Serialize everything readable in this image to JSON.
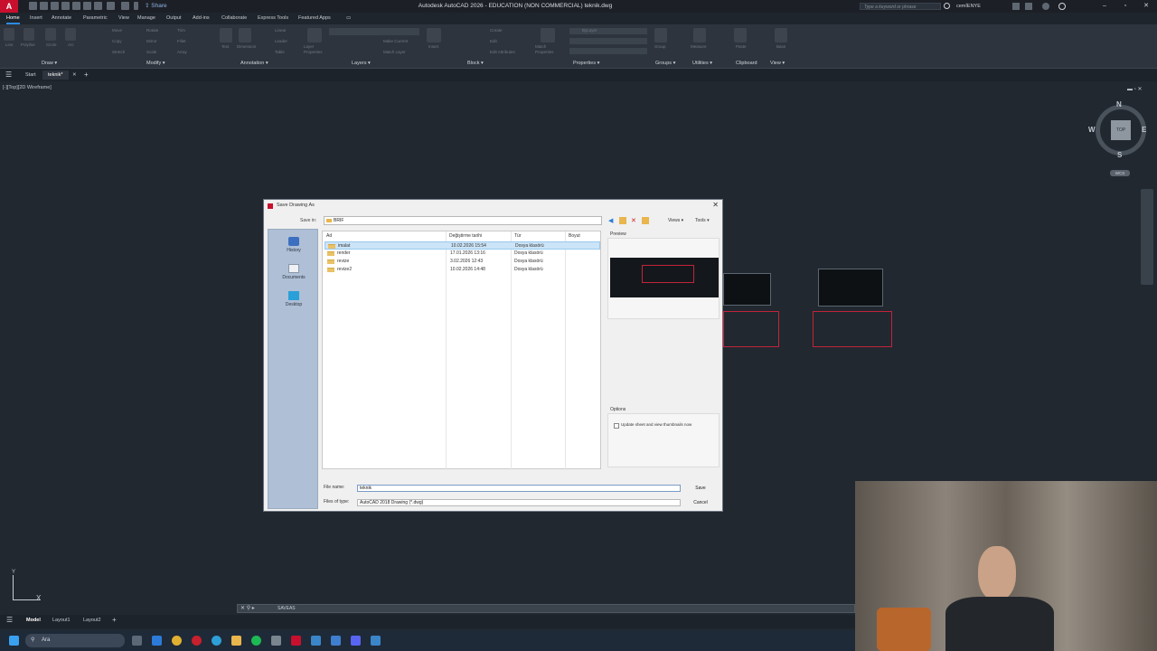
{
  "titlebar": {
    "app_logo": "A",
    "share_label": "Share",
    "window_title": "Autodesk AutoCAD 2026 - EDUCATION (NON COMMERCIAL)   teknik.dwg",
    "search_placeholder": "Type a keyword or phrase",
    "user_name": "cemİENYE"
  },
  "ribbon": {
    "tabs": [
      "Home",
      "Insert",
      "Annotate",
      "Parametric",
      "View",
      "Manage",
      "Output",
      "Add-ins",
      "Collaborate",
      "Express Tools",
      "Featured Apps"
    ],
    "active_tab": "Home",
    "panels": [
      "Draw ▾",
      "Modify ▾",
      "Annotation ▾",
      "Layers ▾",
      "Block ▾",
      "Properties ▾",
      "Groups ▾",
      "Utilities ▾",
      "Clipboard",
      "View ▾"
    ],
    "small_labels": {
      "line": "Line",
      "polyline": "Polyline",
      "circle": "Circle",
      "arc": "Arc",
      "move": "Move",
      "rotate": "Rotate",
      "trim": "Trim",
      "copy": "Copy",
      "mirror": "Mirror",
      "fillet": "Fillet",
      "stretch": "Stretch",
      "scale": "Scale",
      "array": "Array",
      "text": "Text",
      "dimension": "Dimension",
      "linear": "Linear",
      "leader": "Leader",
      "table": "Table",
      "layer_properties": "Layer Properties",
      "make_current": "Make Current",
      "match_layer": "Match Layer",
      "insert": "Insert",
      "create": "Create",
      "edit": "Edit",
      "edit_attributes": "Edit Attributes",
      "match_properties": "Match Properties",
      "bylayer": "ByLayer",
      "group": "Group",
      "measure": "Measure",
      "paste": "Paste",
      "base": "Base"
    }
  },
  "file_tabs": {
    "start": "Start",
    "current": "teknik*"
  },
  "viewport": {
    "label": "[-][Top][2D Wireframe]",
    "viewcube": {
      "top": "TOP",
      "n": "N",
      "s": "S",
      "e": "E",
      "w": "W",
      "wcs": "WCS"
    }
  },
  "dialog": {
    "title": "Save Drawing As",
    "save_in_label": "Save in:",
    "save_in_value": "BRIF",
    "views_menu": "Views",
    "tools_menu": "Tools",
    "places": [
      "History",
      "Documents",
      "Desktop"
    ],
    "columns": [
      "Ad",
      "Değiştirme tarihi",
      "Tür",
      "Boyut"
    ],
    "files": [
      {
        "name": "imalat",
        "date": "10.02.2026 15:54",
        "type": "Dosya klasörü",
        "selected": true
      },
      {
        "name": "render",
        "date": "17.01.2026 13:16",
        "type": "Dosya klasörü",
        "selected": false
      },
      {
        "name": "revize",
        "date": "3.02.2026 12:43",
        "type": "Dosya klasörü",
        "selected": false
      },
      {
        "name": "revize2",
        "date": "10.02.2026 14:48",
        "type": "Dosya klasörü",
        "selected": false
      }
    ],
    "preview_label": "Preview",
    "options_label": "Options",
    "update_thumbnails_label": "Update sheet and view thumbnails now",
    "file_name_label": "File name:",
    "file_name_value": "teknik",
    "file_type_label": "Files of type:",
    "file_type_value": "AutoCAD 2018 Drawing (*.dwg)",
    "save_button": "Save",
    "cancel_button": "Cancel"
  },
  "command_line": {
    "text": "SAVEAS"
  },
  "layout_tabs": [
    "Model",
    "Layout1",
    "Layout2"
  ],
  "taskbar": {
    "search_label": "Ara"
  },
  "colors": {
    "accent": "#2b8be0",
    "brand": "#c8102e",
    "background": "#212830",
    "drawing_red": "#c2243a"
  }
}
